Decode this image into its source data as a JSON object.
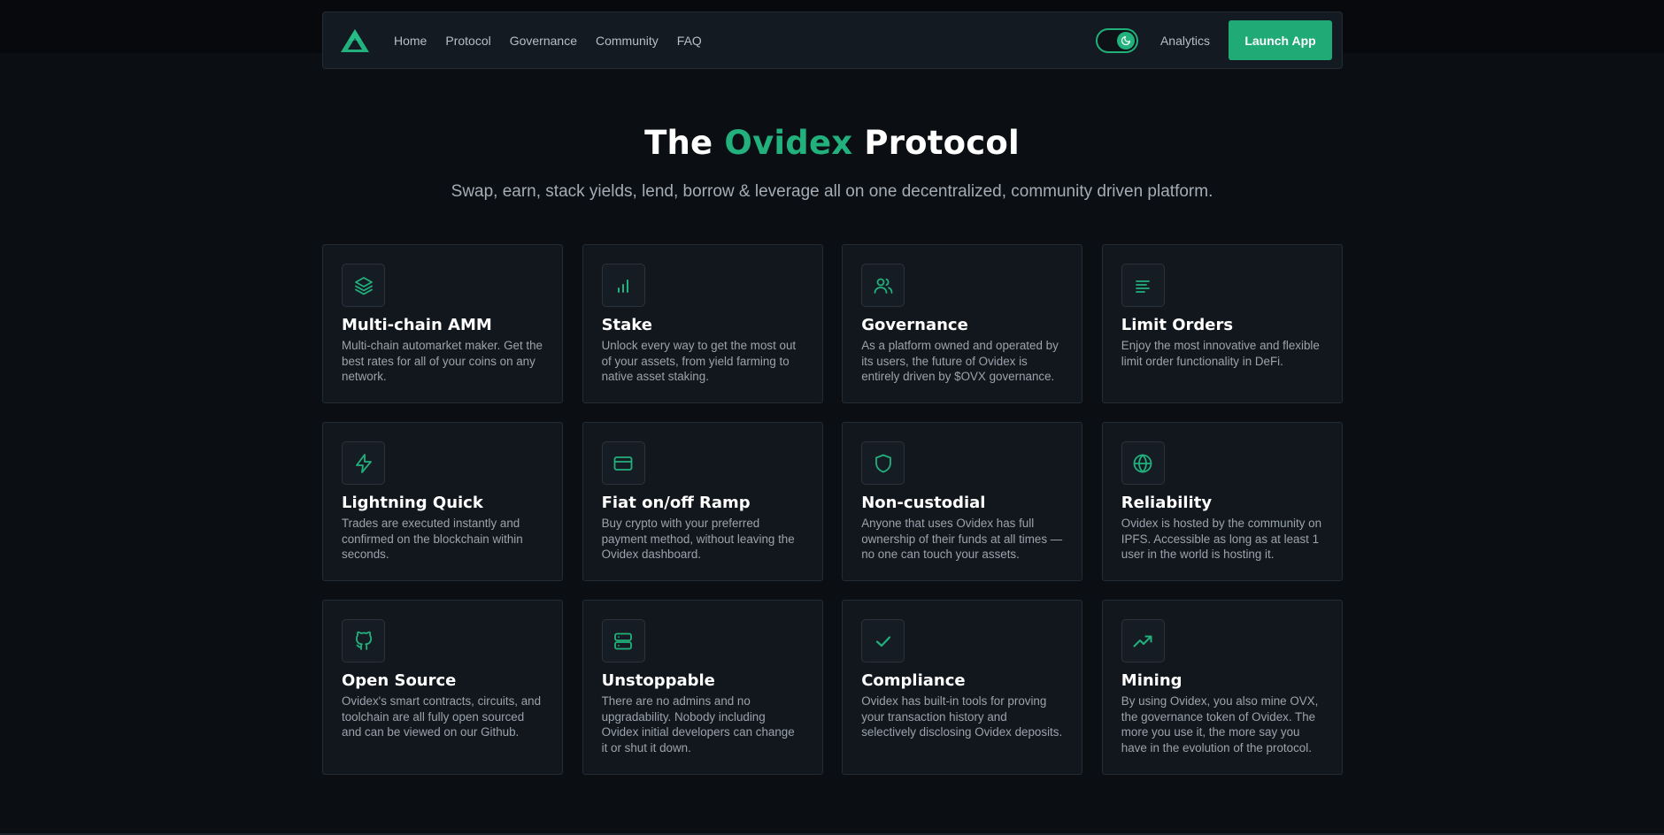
{
  "nav": {
    "links": [
      "Home",
      "Protocol",
      "Governance",
      "Community",
      "FAQ"
    ],
    "analytics": "Analytics",
    "launch": "Launch App",
    "toggle_icon": "moon-icon"
  },
  "hero": {
    "title_prefix": "The ",
    "title_accent": "Ovidex",
    "title_suffix": " Protocol",
    "subtitle": "Swap, earn, stack yields, lend, borrow & leverage all on one decentralized, community driven platform."
  },
  "colors": {
    "accent": "#22b07d",
    "background": "#0b0e12",
    "card": "#12171d"
  },
  "features": [
    {
      "icon": "layers-icon",
      "title": "Multi-chain AMM",
      "desc": "Multi-chain automarket maker. Get the best rates for all of your coins on any network."
    },
    {
      "icon": "bar-chart-icon",
      "title": "Stake",
      "desc": "Unlock every way to get the most out of your assets, from yield farming to native asset staking."
    },
    {
      "icon": "users-icon",
      "title": "Governance",
      "desc": "As a platform owned and operated by its users, the future of Ovidex is entirely driven by $OVX governance."
    },
    {
      "icon": "align-left-icon",
      "title": "Limit Orders",
      "desc": "Enjoy the most innovative and flexible limit order functionality in DeFi."
    },
    {
      "icon": "lightning-icon",
      "title": "Lightning Quick",
      "desc": "Trades are executed instantly and confirmed on the blockchain within seconds."
    },
    {
      "icon": "credit-card-icon",
      "title": "Fiat on/off Ramp",
      "desc": "Buy crypto with your preferred payment method, without leaving the Ovidex dashboard."
    },
    {
      "icon": "shield-icon",
      "title": "Non-custodial",
      "desc": "Anyone that uses Ovidex has full ownership of their funds at all times — no one can touch your assets."
    },
    {
      "icon": "globe-icon",
      "title": "Reliability",
      "desc": "Ovidex is hosted by the community on IPFS. Accessible as long as at least 1 user in the world is hosting it."
    },
    {
      "icon": "github-icon",
      "title": "Open Source",
      "desc": "Ovidex's smart contracts, circuits, and toolchain are all fully open sourced and can be viewed on our Github."
    },
    {
      "icon": "server-icon",
      "title": "Unstoppable",
      "desc": "There are no admins and no upgradability. Nobody including Ovidex initial developers can change it or shut it down."
    },
    {
      "icon": "check-icon",
      "title": "Compliance",
      "desc": "Ovidex has built-in tools for proving your transaction history and selectively disclosing Ovidex deposits."
    },
    {
      "icon": "trending-up-icon",
      "title": "Mining",
      "desc": "By using Ovidex, you also mine OVX, the governance token of Ovidex. The more you use it, the more say you have in the evolution of the protocol."
    }
  ]
}
